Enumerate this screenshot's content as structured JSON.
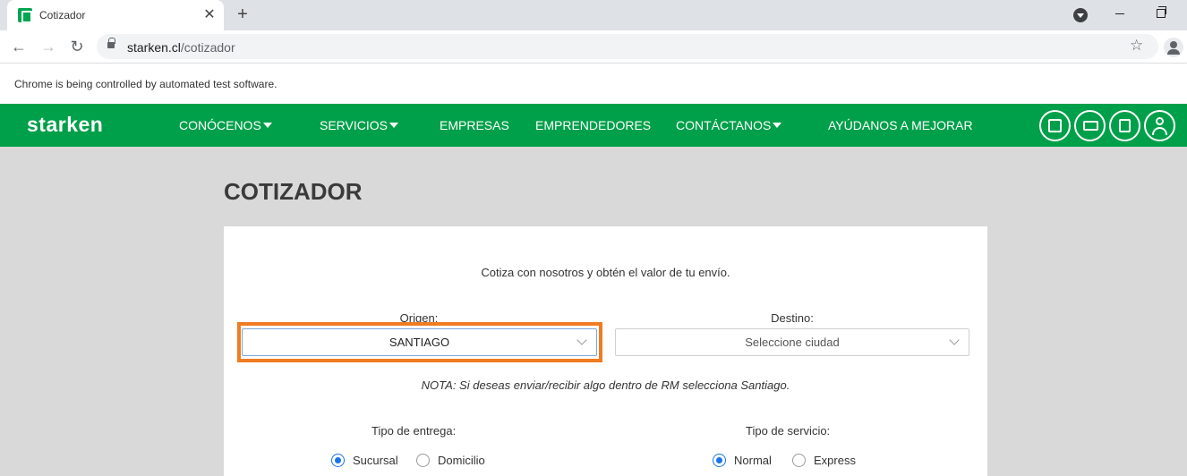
{
  "browser": {
    "tab_title": "Cotizador",
    "tab_close": "✕",
    "new_tab": "+",
    "url_host": "starken.cl",
    "url_path": "/cotizador",
    "infobar": "Chrome is being controlled by automated test software."
  },
  "site": {
    "logo": "starken",
    "nav": [
      {
        "label": "CONÓCENOS",
        "caret": true
      },
      {
        "label": "SERVICIOS",
        "caret": true
      },
      {
        "label": "EMPRESAS",
        "caret": false
      },
      {
        "label": "EMPRENDEDORES",
        "caret": false
      },
      {
        "label": "CONTÁCTANOS",
        "caret": true
      },
      {
        "label": "AYÚDANOS A MEJORAR",
        "caret": false
      }
    ],
    "icons": [
      "box-icon",
      "truck-icon",
      "map-icon",
      "user-icon"
    ],
    "brand_color": "#00a04a"
  },
  "page": {
    "title": "COTIZADOR",
    "intro": "Cotiza con nosotros y obtén el valor de tu envío.",
    "origin_label": "Origen:",
    "origin_value": "SANTIAGO",
    "destination_label": "Destino:",
    "destination_placeholder": "Seleccione ciudad",
    "note": "NOTA: Si deseas enviar/recibir algo dentro de RM selecciona Santiago.",
    "delivery_label": "Tipo de entrega:",
    "delivery_options": [
      {
        "label": "Sucursal",
        "selected": true
      },
      {
        "label": "Domicilio",
        "selected": false
      }
    ],
    "service_label": "Tipo de servicio:",
    "service_options": [
      {
        "label": "Normal",
        "selected": true
      },
      {
        "label": "Express",
        "selected": false
      }
    ],
    "highlight_color": "#f07c22"
  }
}
